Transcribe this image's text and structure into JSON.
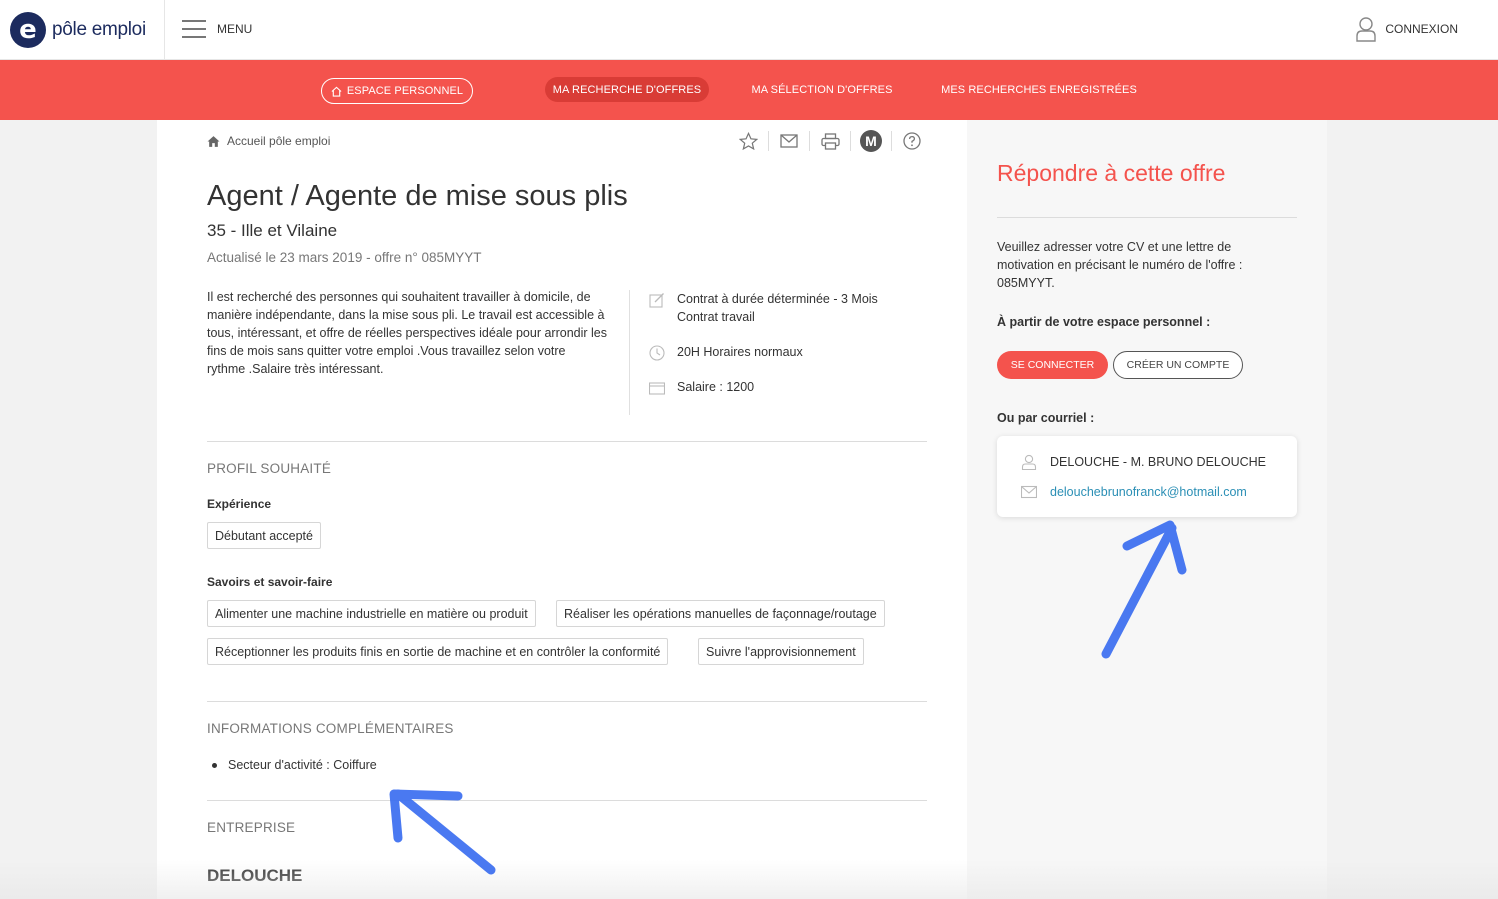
{
  "header": {
    "logo_letter": "e",
    "logo_text": "pôle emploi",
    "menu_label": "MENU",
    "login_label": "CONNEXION"
  },
  "nav": {
    "espace": "ESPACE PERSONNEL",
    "recherche": "MA RECHERCHE D'OFFRES",
    "selection": "MA SÉLECTION D'OFFRES",
    "enregistrees": "MES RECHERCHES ENREGISTRÉES"
  },
  "breadcrumb": {
    "home": "Accueil pôle emploi"
  },
  "job": {
    "title": "Agent / Agente de mise sous plis",
    "location": "35 - Ille et Vilaine",
    "updated": "Actualisé le 23 mars 2019 - offre n° 085MYYT",
    "description": "Il est recherché des personnes qui souhaitent travailler à domicile, de manière indépendante, dans la mise sous pli. Le travail est accessible à tous, intéressant, et offre de réelles perspectives idéale pour arrondir les fins de mois sans quitter votre emploi .Vous travaillez selon votre rythme .Salaire très intéressant.",
    "contract_line1": "Contrat à durée déterminée - 3 Mois",
    "contract_line2": "Contrat travail",
    "hours": "20H Horaires normaux",
    "salary": "Salaire : 1200"
  },
  "profile": {
    "section": "PROFIL SOUHAITÉ",
    "experience_label": "Expérience",
    "experience_value": "Débutant accepté",
    "skills_label": "Savoirs et savoir-faire",
    "skills": [
      "Alimenter une machine industrielle en matière ou produit",
      "Réaliser les opérations manuelles de façonnage/routage",
      "Réceptionner les produits finis en sortie de machine et en contrôler la conformité",
      "Suivre l'approvisionnement"
    ]
  },
  "extra": {
    "section": "INFORMATIONS COMPLÉMENTAIRES",
    "sector": "Secteur d'activité : Coiffure"
  },
  "company": {
    "section": "ENTREPRISE",
    "name": "DELOUCHE"
  },
  "apply": {
    "title": "Répondre à cette offre",
    "text": "Veuillez adresser votre CV et une lettre de motivation en précisant le numéro de l'offre : 085MYYT.",
    "from_space": "À partir de votre espace personnel :",
    "connect_btn": "SE CONNECTER",
    "create_btn": "CRÉER UN COMPTE",
    "by_mail": "Ou par courriel :",
    "contact_name": "DELOUCHE - M. BRUNO DELOUCHE",
    "contact_email": "delouchebrunofranck@hotmail.com"
  },
  "colors": {
    "brand_red": "#f4534d",
    "brand_navy": "#1c2b5e",
    "annotation_blue": "#3b6ef0",
    "link": "#2b8fb5"
  }
}
